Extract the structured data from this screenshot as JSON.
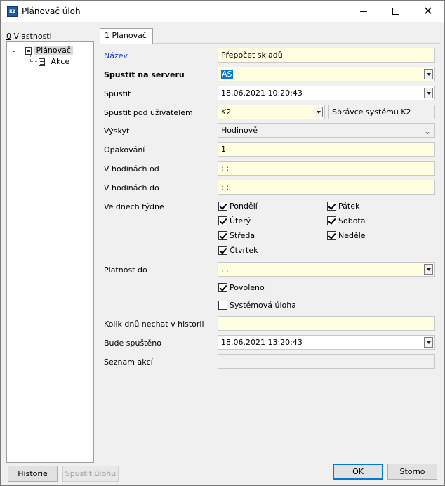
{
  "window": {
    "title": "Plánovač úloh",
    "app_icon": "K2"
  },
  "left_panel": {
    "tab_label": "Vlastnosti",
    "tab_hotkey": "0",
    "tree": [
      {
        "label": "Plánovač",
        "icon": "document-icon",
        "expanded": true,
        "selected": true
      },
      {
        "label": "Akce",
        "icon": "document-icon"
      }
    ]
  },
  "main_tab": {
    "label": "1 Plánovač"
  },
  "form": {
    "nazev": {
      "label": "Název",
      "value": "Přepočet skladů"
    },
    "server": {
      "label": "Spustit na serveru",
      "value": "AS"
    },
    "spustit": {
      "label": "Spustit",
      "value": "18.06.2021 10:20:43"
    },
    "user": {
      "label": "Spustit pod uživatelem",
      "value": "K2",
      "desc": "Správce systému K2"
    },
    "vyskyt": {
      "label": "Výskyt",
      "value": "Hodinově"
    },
    "opakovani": {
      "label": "Opakování",
      "value": "1"
    },
    "hod_od": {
      "label": "V hodinách od",
      "value": " : :"
    },
    "hod_do": {
      "label": "V hodinách do",
      "value": " : :"
    },
    "days": {
      "label": "Ve dnech týdne",
      "items": [
        {
          "label": "Pondělí",
          "checked": true
        },
        {
          "label": "Úterý",
          "checked": true
        },
        {
          "label": "Středa",
          "checked": true
        },
        {
          "label": "Čtvrtek",
          "checked": true
        },
        {
          "label": "Pátek",
          "checked": true
        },
        {
          "label": "Sobota",
          "checked": true
        },
        {
          "label": "Neděle",
          "checked": true
        }
      ]
    },
    "platnost": {
      "label": "Platnost do",
      "value": " . ."
    },
    "povoleno": {
      "label": "Povoleno",
      "checked": true
    },
    "systemova": {
      "label": "Systémová úloha",
      "checked": false
    },
    "historie_dny": {
      "label": "Kolik dnů nechat v historii",
      "value": ""
    },
    "bude": {
      "label": "Bude spuštěno",
      "value": "18.06.2021 13:20:43"
    },
    "seznam": {
      "label": "Seznam akcí",
      "value": ""
    }
  },
  "buttons": {
    "historie": "Historie",
    "spustit_ulohu": "Spustit úlohu",
    "ok": "OK",
    "storno": "Storno"
  },
  "colors": {
    "field_bg": "#fffee0",
    "selection": "#0078d7",
    "label_blue": "#1a3ccf"
  }
}
